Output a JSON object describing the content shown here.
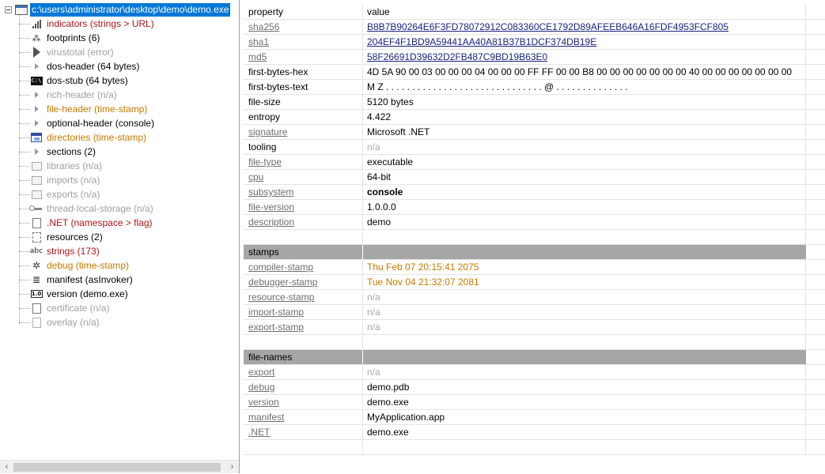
{
  "tree": {
    "root_label": "c:\\users\\administrator\\desktop\\demo\\demo.exe",
    "items": [
      {
        "label": "indicators (strings > URL)",
        "color": "red",
        "icon": "bars-icon"
      },
      {
        "label": "footprints (6)",
        "color": "black",
        "icon": "footprints-icon"
      },
      {
        "label": "virustotal (error)",
        "color": "gray",
        "icon": "virustotal-icon"
      },
      {
        "label": "dos-header (64 bytes)",
        "color": "black",
        "icon": "triangle-icon"
      },
      {
        "label": "dos-stub (64 bytes)",
        "color": "black",
        "icon": "dos-icon"
      },
      {
        "label": "rich-header (n/a)",
        "color": "gray",
        "icon": "triangle-icon"
      },
      {
        "label": "file-header (time-stamp)",
        "color": "orange",
        "icon": "triangle-icon"
      },
      {
        "label": "optional-header (console)",
        "color": "black",
        "icon": "triangle-icon"
      },
      {
        "label": "directories (time-stamp)",
        "color": "orange",
        "icon": "directories-icon"
      },
      {
        "label": "sections (2)",
        "color": "black",
        "icon": "triangle-icon"
      },
      {
        "label": "libraries (n/a)",
        "color": "gray",
        "icon": "libraries-icon"
      },
      {
        "label": "imports (n/a)",
        "color": "gray",
        "icon": "imports-icon"
      },
      {
        "label": "exports (n/a)",
        "color": "gray",
        "icon": "exports-icon"
      },
      {
        "label": "thread-local-storage (n/a)",
        "color": "gray",
        "icon": "key-icon"
      },
      {
        "label": ".NET (namespace > flag)",
        "color": "red",
        "icon": "dotnet-icon"
      },
      {
        "label": "resources (2)",
        "color": "black",
        "icon": "resources-icon"
      },
      {
        "label": "strings (173)",
        "color": "red",
        "icon": "abc-icon"
      },
      {
        "label": "debug (time-stamp)",
        "color": "orange",
        "icon": "bug-icon"
      },
      {
        "label": "manifest (asInvoker)",
        "color": "black",
        "icon": "manifest-icon"
      },
      {
        "label": "version (demo.exe)",
        "color": "black",
        "icon": "version-icon"
      },
      {
        "label": "certificate (n/a)",
        "color": "gray",
        "icon": "certificate-icon"
      },
      {
        "label": "overlay (n/a)",
        "color": "gray",
        "icon": "overlay-icon"
      }
    ]
  },
  "grid": {
    "header": {
      "property": "property",
      "value": "value"
    },
    "rows": [
      {
        "k": "sha256",
        "v": "B8B7B90264E6F3FD78072912C083360CE1792D89AFEEB646A16FDF4953FCF805",
        "klink": true,
        "vstyle": "link"
      },
      {
        "k": "sha1",
        "v": "204EF4F1BD9A59441AA40A81B37B1DCF374DB19E",
        "klink": true,
        "vstyle": "link"
      },
      {
        "k": "md5",
        "v": "58F26691D39632D2FB487C9BD19B63E0",
        "klink": true,
        "vstyle": "link"
      },
      {
        "k": "first-bytes-hex",
        "v": "4D 5A 90 00 03 00 00 00 04 00 00 00 FF FF 00 00 B8 00 00 00 00 00 00 00 40 00 00 00 00 00 00 00",
        "klink": false,
        "vstyle": ""
      },
      {
        "k": "first-bytes-text",
        "v": "M Z . . . . . . . . . . . . . . . . . . . . . . . . . . . . . . @ . . . . . . . . . . . . . .",
        "klink": false,
        "vstyle": ""
      },
      {
        "k": "file-size",
        "v": "5120 bytes",
        "klink": false,
        "vstyle": ""
      },
      {
        "k": "entropy",
        "v": "4.422",
        "klink": false,
        "vstyle": ""
      },
      {
        "k": "signature",
        "v": "Microsoft .NET",
        "klink": true,
        "vstyle": ""
      },
      {
        "k": "tooling",
        "v": "n/a",
        "klink": false,
        "vstyle": "gray"
      },
      {
        "k": "file-type",
        "v": "executable",
        "klink": true,
        "vstyle": ""
      },
      {
        "k": "cpu",
        "v": "64-bit",
        "klink": true,
        "vstyle": ""
      },
      {
        "k": "subsystem",
        "v": "console",
        "klink": true,
        "vstyle": "bold"
      },
      {
        "k": "file-version",
        "v": "1.0.0.0",
        "klink": true,
        "vstyle": ""
      },
      {
        "k": "description",
        "v": "demo",
        "klink": true,
        "vstyle": ""
      },
      {
        "k": "",
        "v": "",
        "klink": false,
        "vstyle": "blank"
      },
      {
        "k": "stamps",
        "v": "",
        "klink": false,
        "vstyle": "section"
      },
      {
        "k": "compiler-stamp",
        "v": "Thu Feb 07 20:15:41 2075",
        "klink": true,
        "vstyle": "orange"
      },
      {
        "k": "debugger-stamp",
        "v": "Tue Nov 04 21:32:07 2081",
        "klink": true,
        "vstyle": "orange"
      },
      {
        "k": "resource-stamp",
        "v": "n/a",
        "klink": true,
        "vstyle": "gray"
      },
      {
        "k": "import-stamp",
        "v": "n/a",
        "klink": true,
        "vstyle": "gray"
      },
      {
        "k": "export-stamp",
        "v": "n/a",
        "klink": true,
        "vstyle": "gray"
      },
      {
        "k": "",
        "v": "",
        "klink": false,
        "vstyle": "blank"
      },
      {
        "k": "file-names",
        "v": "",
        "klink": false,
        "vstyle": "section"
      },
      {
        "k": "export",
        "v": "n/a",
        "klink": true,
        "vstyle": "gray"
      },
      {
        "k": "debug",
        "v": "demo.pdb",
        "klink": true,
        "vstyle": ""
      },
      {
        "k": "version",
        "v": "demo.exe",
        "klink": true,
        "vstyle": ""
      },
      {
        "k": "manifest",
        "v": "MyApplication.app",
        "klink": true,
        "vstyle": ""
      },
      {
        "k": ".NET",
        "v": "demo.exe",
        "klink": true,
        "vstyle": ""
      },
      {
        "k": "",
        "v": "",
        "klink": false,
        "vstyle": "blank"
      }
    ]
  },
  "scroll": {
    "left_arrow": "‹",
    "right_arrow": "›"
  }
}
